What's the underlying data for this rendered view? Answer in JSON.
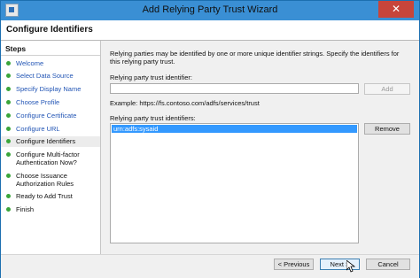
{
  "window": {
    "title": "Add Relying Party Trust Wizard",
    "close_glyph": "✕"
  },
  "header": {
    "title": "Configure Identifiers"
  },
  "steps": {
    "title": "Steps",
    "items": [
      {
        "label": "Welcome",
        "state": "done"
      },
      {
        "label": "Select Data Source",
        "state": "done"
      },
      {
        "label": "Specify Display Name",
        "state": "done"
      },
      {
        "label": "Choose Profile",
        "state": "done"
      },
      {
        "label": "Configure Certificate",
        "state": "done"
      },
      {
        "label": "Configure URL",
        "state": "done"
      },
      {
        "label": "Configure Identifiers",
        "state": "current"
      },
      {
        "label_lines": [
          "Configure Multi-factor",
          "Authentication Now?"
        ],
        "state": "future"
      },
      {
        "label_lines": [
          "Choose Issuance",
          "Authorization Rules"
        ],
        "state": "future"
      },
      {
        "label": "Ready to Add Trust",
        "state": "future"
      },
      {
        "label": "Finish",
        "state": "future"
      }
    ]
  },
  "content": {
    "description": "Relying parties may be identified by one or more unique identifier strings. Specify the identifiers for this relying party trust.",
    "identifier_label": "Relying party trust identifier:",
    "identifier_value": "",
    "add_label": "Add",
    "example": "Example: https://fs.contoso.com/adfs/services/trust",
    "identifiers_label": "Relying party trust identifiers:",
    "identifiers": [
      "urn:adfs:sysaid"
    ],
    "remove_label": "Remove"
  },
  "footer": {
    "previous_label": "< Previous",
    "next_label": "Next >",
    "cancel_label": "Cancel"
  },
  "colors": {
    "titlebar": "#3a8fd4",
    "selection": "#3399ff",
    "step_done": "#2255b5",
    "bullet": "#3aa53a"
  }
}
